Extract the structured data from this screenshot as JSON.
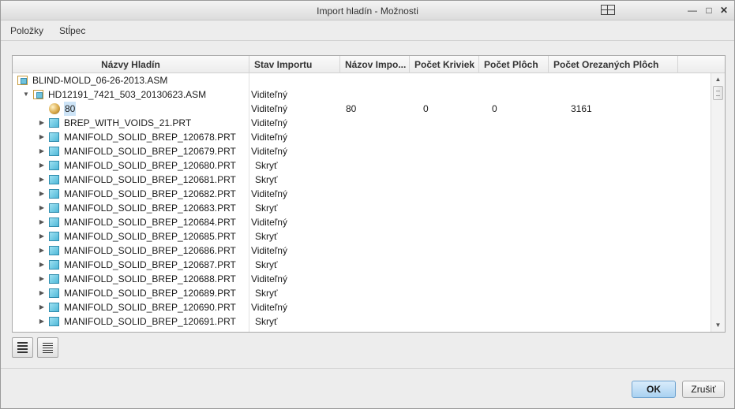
{
  "window": {
    "title": "Import hladín - Možnosti"
  },
  "menu": {
    "items": [
      "Položky",
      "Stĺpec"
    ]
  },
  "table": {
    "columns": [
      "Názvy Hladín",
      "Stav Importu",
      "Názov Impo...",
      "Počet Kriviek",
      "Počet Plôch",
      "Počet Orezaných Plôch"
    ],
    "rows": [
      {
        "name": "BLIND-MOLD_06-26-2013.ASM",
        "icon": "assembly-icon",
        "level": 0,
        "expander": "",
        "status": "",
        "import_name": "",
        "curves": "",
        "surfaces": "",
        "trimmed": ""
      },
      {
        "name": "HD12191_7421_503_20130623.ASM",
        "icon": "assembly-icon",
        "level": 1,
        "expander": "▼",
        "status": "Viditeľný",
        "import_name": "",
        "curves": "",
        "surfaces": "",
        "trimmed": ""
      },
      {
        "name": "80",
        "icon": "layer-sphere-icon",
        "level": 2,
        "expander": "",
        "selected": true,
        "status": "Viditeľný",
        "import_name": "80",
        "curves": "0",
        "surfaces": "0",
        "trimmed": "3161"
      },
      {
        "name": "BREP_WITH_VOIDS_21.PRT",
        "icon": "part-icon",
        "level": 2,
        "expander": "▶",
        "status": "Viditeľný",
        "import_name": "",
        "curves": "",
        "surfaces": "",
        "trimmed": ""
      },
      {
        "name": "MANIFOLD_SOLID_BREP_120678.PRT",
        "icon": "part-icon",
        "level": 2,
        "expander": "▶",
        "status": "Viditeľný",
        "import_name": "",
        "curves": "",
        "surfaces": "",
        "trimmed": ""
      },
      {
        "name": "MANIFOLD_SOLID_BREP_120679.PRT",
        "icon": "part-icon",
        "level": 2,
        "expander": "▶",
        "status": "Viditeľný",
        "import_name": "",
        "curves": "",
        "surfaces": "",
        "trimmed": ""
      },
      {
        "name": "MANIFOLD_SOLID_BREP_120680.PRT",
        "icon": "part-icon",
        "level": 2,
        "expander": "▶",
        "status": "Skryť",
        "import_name": "",
        "curves": "",
        "surfaces": "",
        "trimmed": ""
      },
      {
        "name": "MANIFOLD_SOLID_BREP_120681.PRT",
        "icon": "part-icon",
        "level": 2,
        "expander": "▶",
        "status": "Skryť",
        "import_name": "",
        "curves": "",
        "surfaces": "",
        "trimmed": ""
      },
      {
        "name": "MANIFOLD_SOLID_BREP_120682.PRT",
        "icon": "part-icon",
        "level": 2,
        "expander": "▶",
        "status": "Viditeľný",
        "import_name": "",
        "curves": "",
        "surfaces": "",
        "trimmed": ""
      },
      {
        "name": "MANIFOLD_SOLID_BREP_120683.PRT",
        "icon": "part-icon",
        "level": 2,
        "expander": "▶",
        "status": "Skryť",
        "import_name": "",
        "curves": "",
        "surfaces": "",
        "trimmed": ""
      },
      {
        "name": "MANIFOLD_SOLID_BREP_120684.PRT",
        "icon": "part-icon",
        "level": 2,
        "expander": "▶",
        "status": "Viditeľný",
        "import_name": "",
        "curves": "",
        "surfaces": "",
        "trimmed": ""
      },
      {
        "name": "MANIFOLD_SOLID_BREP_120685.PRT",
        "icon": "part-icon",
        "level": 2,
        "expander": "▶",
        "status": "Skryť",
        "import_name": "",
        "curves": "",
        "surfaces": "",
        "trimmed": ""
      },
      {
        "name": "MANIFOLD_SOLID_BREP_120686.PRT",
        "icon": "part-icon",
        "level": 2,
        "expander": "▶",
        "status": "Viditeľný",
        "import_name": "",
        "curves": "",
        "surfaces": "",
        "trimmed": ""
      },
      {
        "name": "MANIFOLD_SOLID_BREP_120687.PRT",
        "icon": "part-icon",
        "level": 2,
        "expander": "▶",
        "status": "Skryť",
        "import_name": "",
        "curves": "",
        "surfaces": "",
        "trimmed": ""
      },
      {
        "name": "MANIFOLD_SOLID_BREP_120688.PRT",
        "icon": "part-icon",
        "level": 2,
        "expander": "▶",
        "status": "Viditeľný",
        "import_name": "",
        "curves": "",
        "surfaces": "",
        "trimmed": ""
      },
      {
        "name": "MANIFOLD_SOLID_BREP_120689.PRT",
        "icon": "part-icon",
        "level": 2,
        "expander": "▶",
        "status": "Skryť",
        "import_name": "",
        "curves": "",
        "surfaces": "",
        "trimmed": ""
      },
      {
        "name": "MANIFOLD_SOLID_BREP_120690.PRT",
        "icon": "part-icon",
        "level": 2,
        "expander": "▶",
        "status": "Viditeľný",
        "import_name": "",
        "curves": "",
        "surfaces": "",
        "trimmed": ""
      },
      {
        "name": "MANIFOLD_SOLID_BREP_120691.PRT",
        "icon": "part-icon",
        "level": 2,
        "expander": "▶",
        "status": "Skryť",
        "import_name": "",
        "curves": "",
        "surfaces": "",
        "trimmed": ""
      }
    ]
  },
  "footer": {
    "ok_label": "OK",
    "cancel_label": "Zrušiť"
  },
  "colors": {
    "ok_button": "#a9d1f1",
    "selection": "#cde4f7"
  }
}
